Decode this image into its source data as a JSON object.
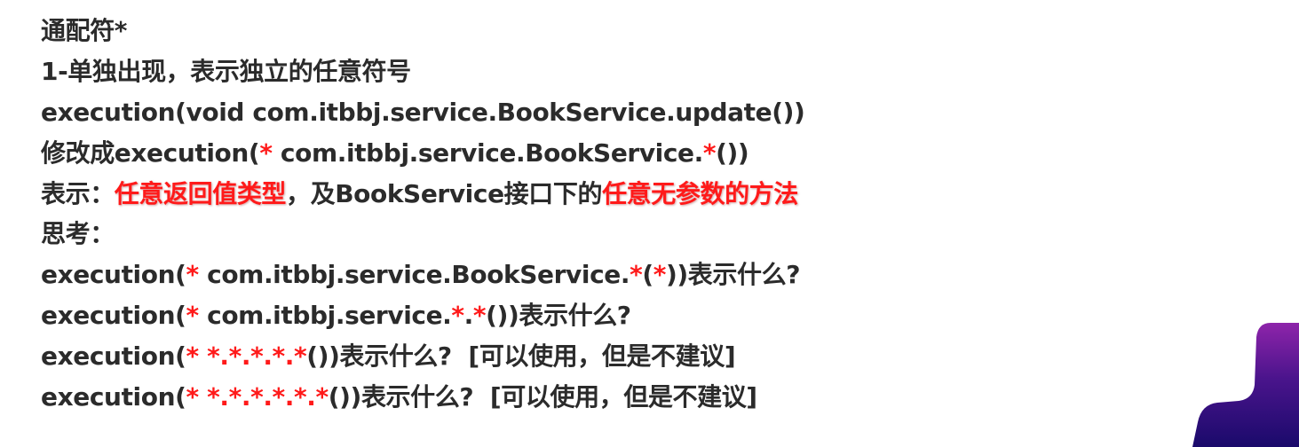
{
  "lines": [
    [
      {
        "t": "通配符*",
        "s": "n"
      }
    ],
    [
      {
        "t": "1-单独出现，表示独立的任意符号",
        "s": "n"
      }
    ],
    [
      {
        "t": "execution(void com.itbbj.service.BookService.update())",
        "s": "n"
      }
    ],
    [
      {
        "t": "修改成execution(",
        "s": "n"
      },
      {
        "t": "*",
        "s": "r"
      },
      {
        "t": " com.itbbj.service.BookService.",
        "s": "n"
      },
      {
        "t": "*",
        "s": "r"
      },
      {
        "t": "())",
        "s": "n"
      }
    ],
    [
      {
        "t": "表示：",
        "s": "n"
      },
      {
        "t": "任意返回值类型",
        "s": "e"
      },
      {
        "t": "，及BookService接口下的",
        "s": "n"
      },
      {
        "t": "任意无参数的方法",
        "s": "e"
      }
    ],
    [
      {
        "t": "思考：",
        "s": "n"
      }
    ],
    [
      {
        "t": "execution(",
        "s": "n"
      },
      {
        "t": "*",
        "s": "r"
      },
      {
        "t": " com.itbbj.service.BookService.",
        "s": "n"
      },
      {
        "t": "*",
        "s": "r"
      },
      {
        "t": "(",
        "s": "n"
      },
      {
        "t": "*",
        "s": "r"
      },
      {
        "t": "))表示什么?",
        "s": "n"
      }
    ],
    [
      {
        "t": "execution(",
        "s": "n"
      },
      {
        "t": "*",
        "s": "r"
      },
      {
        "t": " com.itbbj.service.",
        "s": "n"
      },
      {
        "t": "*",
        "s": "r"
      },
      {
        "t": ".",
        "s": "n"
      },
      {
        "t": "*",
        "s": "r"
      },
      {
        "t": "())表示什么?",
        "s": "n"
      }
    ],
    [
      {
        "t": "execution(",
        "s": "n"
      },
      {
        "t": "* *.*.*.*.*",
        "s": "r"
      },
      {
        "t": "())表示什么?  [可以使用，但是不建议]",
        "s": "n"
      }
    ],
    [
      {
        "t": "execution(",
        "s": "n"
      },
      {
        "t": "* *.*.*.*.*.*",
        "s": "r"
      },
      {
        "t": "())表示什么?  [可以使用，但是不建议]",
        "s": "n"
      }
    ]
  ],
  "colors": {
    "text": "#2b2b2b",
    "highlight": "#ff1a1a",
    "decor_purple": "#7b1fa2",
    "decor_navy": "#1a0a6b"
  }
}
